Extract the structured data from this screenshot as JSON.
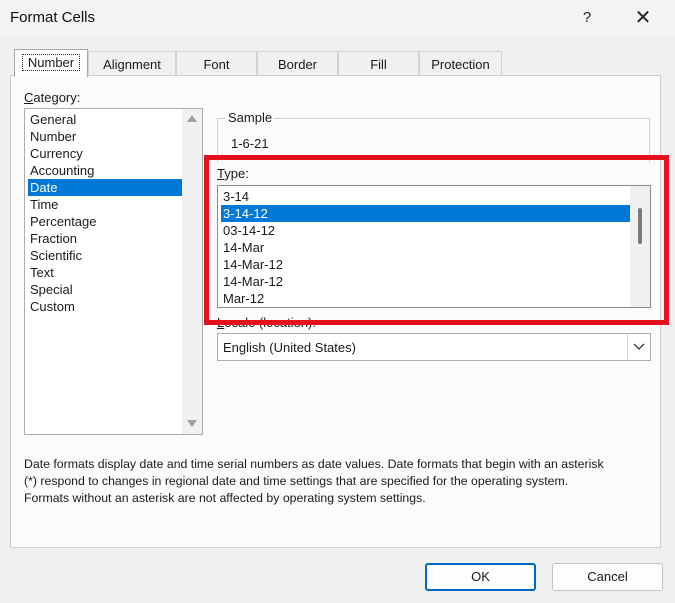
{
  "window": {
    "title": "Format Cells",
    "help": "?",
    "close": "✕"
  },
  "tabs": [
    "Number",
    "Alignment",
    "Font",
    "Border",
    "Fill",
    "Protection"
  ],
  "category": {
    "label": "Category:",
    "items": [
      "General",
      "Number",
      "Currency",
      "Accounting",
      "Date",
      "Time",
      "Percentage",
      "Fraction",
      "Scientific",
      "Text",
      "Special",
      "Custom"
    ],
    "selected": "Date"
  },
  "sample": {
    "label": "Sample",
    "value": "1-6-21"
  },
  "type": {
    "label": "Type:",
    "items": [
      "3-14",
      "3-14-12",
      "03-14-12",
      "14-Mar",
      "14-Mar-12",
      "14-Mar-12",
      "Mar-12"
    ],
    "selected": "3-14-12"
  },
  "locale": {
    "label": "Locale (location):",
    "value": "English (United States)"
  },
  "description": [
    "Date formats display date and time serial numbers as date values.  Date formats that begin with an asterisk",
    "(*) respond to changes in regional date and time settings that are specified for the operating system.",
    "Formats without an asterisk are not affected by operating system settings."
  ],
  "buttons": {
    "ok": "OK",
    "cancel": "Cancel"
  },
  "colors": {
    "selection": "#0078d7",
    "highlight_box": "#e8101a",
    "primary_border": "#0067c0"
  }
}
